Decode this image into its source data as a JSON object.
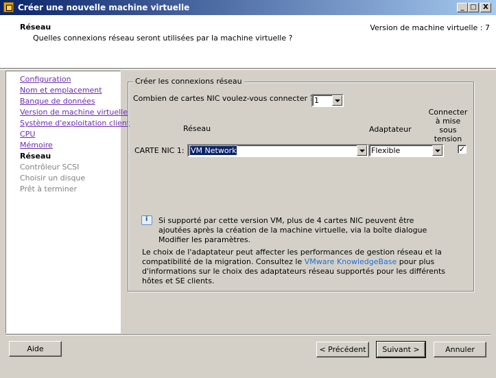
{
  "window": {
    "title": "Créer une nouvelle machine virtuelle",
    "controls": {
      "minimize": "_",
      "maximize": "□",
      "close": "X"
    }
  },
  "header": {
    "title": "Réseau",
    "subtitle": "Quelles connexions réseau seront utilisées par la machine virtuelle ?",
    "version": "Version de machine virtuelle : 7"
  },
  "nav": {
    "items": [
      {
        "label": "Configuration",
        "state": "done"
      },
      {
        "label": "Nom et emplacement",
        "state": "done"
      },
      {
        "label": "Banque de données",
        "state": "done"
      },
      {
        "label": "Version de machine virtuelle",
        "state": "done"
      },
      {
        "label": "Système d'exploitation client",
        "state": "done"
      },
      {
        "label": "CPU",
        "state": "done"
      },
      {
        "label": "Mémoire",
        "state": "done"
      },
      {
        "label": "Réseau",
        "state": "current"
      },
      {
        "label": "Contrôleur SCSI",
        "state": "future"
      },
      {
        "label": "Choisir un disque",
        "state": "future"
      },
      {
        "label": "Prêt à terminer",
        "state": "future"
      }
    ]
  },
  "network": {
    "group_title": "Créer les connexions réseau",
    "nic_count_label": "Combien de cartes NIC voulez-vous connecter ?",
    "nic_count_value": "1",
    "col_network": "Réseau",
    "col_adapter": "Adaptateur",
    "col_connect": "Connecter à mise sous tension",
    "nic_label": "CARTE NIC 1:",
    "nic_network": "VM Network",
    "nic_adapter": "Flexible",
    "nic_connect_checked": true,
    "info_text": "Si supporté par cette version VM, plus de 4 cartes NIC peuvent être ajoutées après la création de la machine virtuelle, via la boîte dialogue Modifier les paramètres.",
    "adapter_text_before": "Le choix de l'adaptateur peut affecter les performances de gestion réseau et la compatibilité de la migration. Consultez le ",
    "adapter_link": "VMware KnowledgeBase",
    "adapter_text_after": " pour plus d'informations sur le choix des adaptateurs réseau supportés pour les différents hôtes et SE clients."
  },
  "buttons": {
    "help": "Aide",
    "back": "< Précédent",
    "next": "Suivant >",
    "cancel": "Annuler"
  },
  "colors": {
    "titlebar": "#0a246a",
    "visited_link": "#6b2bb0",
    "link": "#1f6fd0",
    "selection": "#0a246a"
  }
}
